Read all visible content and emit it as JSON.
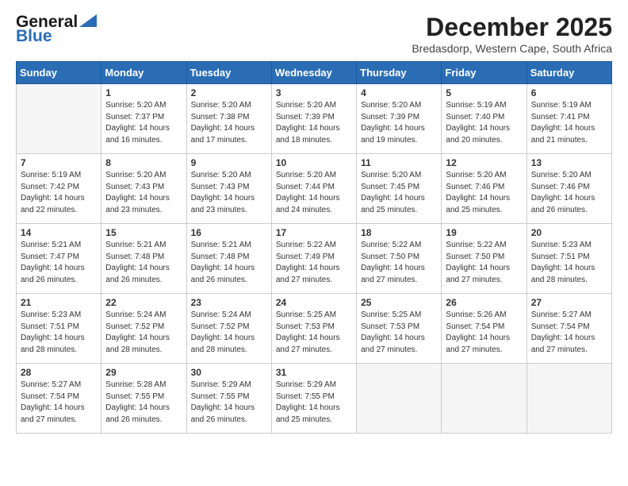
{
  "logo": {
    "line1": "General",
    "line2": "Blue"
  },
  "title": "December 2025",
  "location": "Bredasdorp, Western Cape, South Africa",
  "days_header": [
    "Sunday",
    "Monday",
    "Tuesday",
    "Wednesday",
    "Thursday",
    "Friday",
    "Saturday"
  ],
  "weeks": [
    [
      {
        "num": "",
        "info": ""
      },
      {
        "num": "1",
        "info": "Sunrise: 5:20 AM\nSunset: 7:37 PM\nDaylight: 14 hours\nand 16 minutes."
      },
      {
        "num": "2",
        "info": "Sunrise: 5:20 AM\nSunset: 7:38 PM\nDaylight: 14 hours\nand 17 minutes."
      },
      {
        "num": "3",
        "info": "Sunrise: 5:20 AM\nSunset: 7:39 PM\nDaylight: 14 hours\nand 18 minutes."
      },
      {
        "num": "4",
        "info": "Sunrise: 5:20 AM\nSunset: 7:39 PM\nDaylight: 14 hours\nand 19 minutes."
      },
      {
        "num": "5",
        "info": "Sunrise: 5:19 AM\nSunset: 7:40 PM\nDaylight: 14 hours\nand 20 minutes."
      },
      {
        "num": "6",
        "info": "Sunrise: 5:19 AM\nSunset: 7:41 PM\nDaylight: 14 hours\nand 21 minutes."
      }
    ],
    [
      {
        "num": "7",
        "info": "Sunrise: 5:19 AM\nSunset: 7:42 PM\nDaylight: 14 hours\nand 22 minutes."
      },
      {
        "num": "8",
        "info": "Sunrise: 5:20 AM\nSunset: 7:43 PM\nDaylight: 14 hours\nand 23 minutes."
      },
      {
        "num": "9",
        "info": "Sunrise: 5:20 AM\nSunset: 7:43 PM\nDaylight: 14 hours\nand 23 minutes."
      },
      {
        "num": "10",
        "info": "Sunrise: 5:20 AM\nSunset: 7:44 PM\nDaylight: 14 hours\nand 24 minutes."
      },
      {
        "num": "11",
        "info": "Sunrise: 5:20 AM\nSunset: 7:45 PM\nDaylight: 14 hours\nand 25 minutes."
      },
      {
        "num": "12",
        "info": "Sunrise: 5:20 AM\nSunset: 7:46 PM\nDaylight: 14 hours\nand 25 minutes."
      },
      {
        "num": "13",
        "info": "Sunrise: 5:20 AM\nSunset: 7:46 PM\nDaylight: 14 hours\nand 26 minutes."
      }
    ],
    [
      {
        "num": "14",
        "info": "Sunrise: 5:21 AM\nSunset: 7:47 PM\nDaylight: 14 hours\nand 26 minutes."
      },
      {
        "num": "15",
        "info": "Sunrise: 5:21 AM\nSunset: 7:48 PM\nDaylight: 14 hours\nand 26 minutes."
      },
      {
        "num": "16",
        "info": "Sunrise: 5:21 AM\nSunset: 7:48 PM\nDaylight: 14 hours\nand 26 minutes."
      },
      {
        "num": "17",
        "info": "Sunrise: 5:22 AM\nSunset: 7:49 PM\nDaylight: 14 hours\nand 27 minutes."
      },
      {
        "num": "18",
        "info": "Sunrise: 5:22 AM\nSunset: 7:50 PM\nDaylight: 14 hours\nand 27 minutes."
      },
      {
        "num": "19",
        "info": "Sunrise: 5:22 AM\nSunset: 7:50 PM\nDaylight: 14 hours\nand 27 minutes."
      },
      {
        "num": "20",
        "info": "Sunrise: 5:23 AM\nSunset: 7:51 PM\nDaylight: 14 hours\nand 28 minutes."
      }
    ],
    [
      {
        "num": "21",
        "info": "Sunrise: 5:23 AM\nSunset: 7:51 PM\nDaylight: 14 hours\nand 28 minutes."
      },
      {
        "num": "22",
        "info": "Sunrise: 5:24 AM\nSunset: 7:52 PM\nDaylight: 14 hours\nand 28 minutes."
      },
      {
        "num": "23",
        "info": "Sunrise: 5:24 AM\nSunset: 7:52 PM\nDaylight: 14 hours\nand 28 minutes."
      },
      {
        "num": "24",
        "info": "Sunrise: 5:25 AM\nSunset: 7:53 PM\nDaylight: 14 hours\nand 27 minutes."
      },
      {
        "num": "25",
        "info": "Sunrise: 5:25 AM\nSunset: 7:53 PM\nDaylight: 14 hours\nand 27 minutes."
      },
      {
        "num": "26",
        "info": "Sunrise: 5:26 AM\nSunset: 7:54 PM\nDaylight: 14 hours\nand 27 minutes."
      },
      {
        "num": "27",
        "info": "Sunrise: 5:27 AM\nSunset: 7:54 PM\nDaylight: 14 hours\nand 27 minutes."
      }
    ],
    [
      {
        "num": "28",
        "info": "Sunrise: 5:27 AM\nSunset: 7:54 PM\nDaylight: 14 hours\nand 27 minutes."
      },
      {
        "num": "29",
        "info": "Sunrise: 5:28 AM\nSunset: 7:55 PM\nDaylight: 14 hours\nand 26 minutes."
      },
      {
        "num": "30",
        "info": "Sunrise: 5:29 AM\nSunset: 7:55 PM\nDaylight: 14 hours\nand 26 minutes."
      },
      {
        "num": "31",
        "info": "Sunrise: 5:29 AM\nSunset: 7:55 PM\nDaylight: 14 hours\nand 25 minutes."
      },
      {
        "num": "",
        "info": ""
      },
      {
        "num": "",
        "info": ""
      },
      {
        "num": "",
        "info": ""
      }
    ]
  ]
}
